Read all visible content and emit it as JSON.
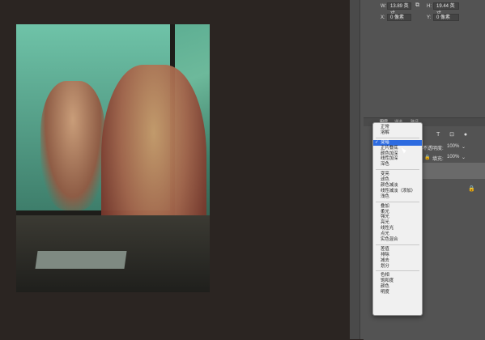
{
  "canvas": {
    "image_alt": "photo-of-woman-by-mirror"
  },
  "properties": {
    "w_label": "W:",
    "w_value": "13.89 英寸",
    "h_label": "H:",
    "h_value": "19.44 英寸",
    "x_label": "X:",
    "x_value": "0 像素",
    "y_label": "Y:",
    "y_value": "0 像素"
  },
  "layers_panel": {
    "tabs": [
      "图层",
      "通道",
      "路径"
    ],
    "opacity_label": "不透明度:",
    "opacity_value": "100%",
    "fill_label": "填充:",
    "fill_value": "100%"
  },
  "blend_menu": {
    "selected": "变暗",
    "groups": [
      [
        "正常",
        "溶解"
      ],
      [
        "变暗",
        "正片叠底",
        "颜色加深",
        "线性加深",
        "深色"
      ],
      [
        "变亮",
        "滤色",
        "颜色减淡",
        "线性减淡（添加）",
        "浅色"
      ],
      [
        "叠加",
        "柔光",
        "强光",
        "亮光",
        "线性光",
        "点光",
        "实色混合"
      ],
      [
        "差值",
        "排除",
        "减去",
        "划分"
      ],
      [
        "色相",
        "饱和度",
        "颜色",
        "明度"
      ]
    ]
  },
  "colors": {
    "workspace_bg": "#2b2522",
    "panel_bg": "#535353",
    "menu_bg": "#f0f0f0",
    "selection": "#2d6be0"
  }
}
